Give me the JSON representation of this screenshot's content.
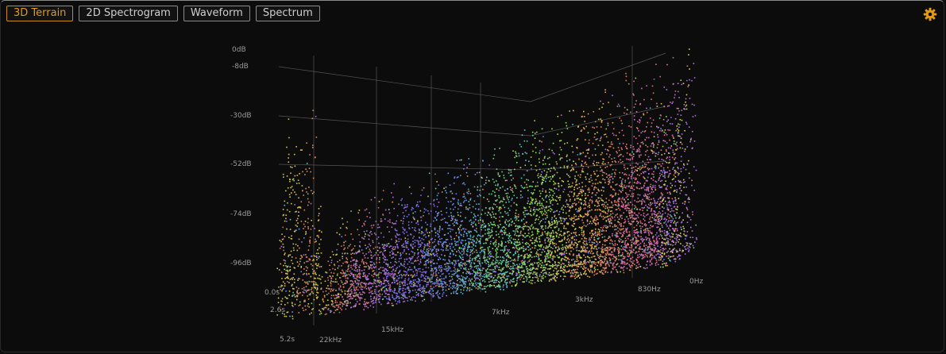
{
  "tabs": [
    {
      "label": "3D Terrain",
      "active": true
    },
    {
      "label": "2D Spectrogram",
      "active": false
    },
    {
      "label": "Waveform",
      "active": false
    },
    {
      "label": "Spectrum",
      "active": false
    }
  ],
  "settings_icon": "gear-icon",
  "accent_color": "#e39a17",
  "plot": {
    "db_labels": [
      "0dB",
      "-8dB",
      "-30dB",
      "-52dB",
      "-74dB",
      "-96dB"
    ],
    "time_labels": [
      "0.0s",
      "2.6s",
      "5.2s"
    ],
    "freq_labels": [
      "22kHz",
      "15kHz",
      "7kHz",
      "3kHz",
      "830Hz",
      "0Hz"
    ]
  }
}
